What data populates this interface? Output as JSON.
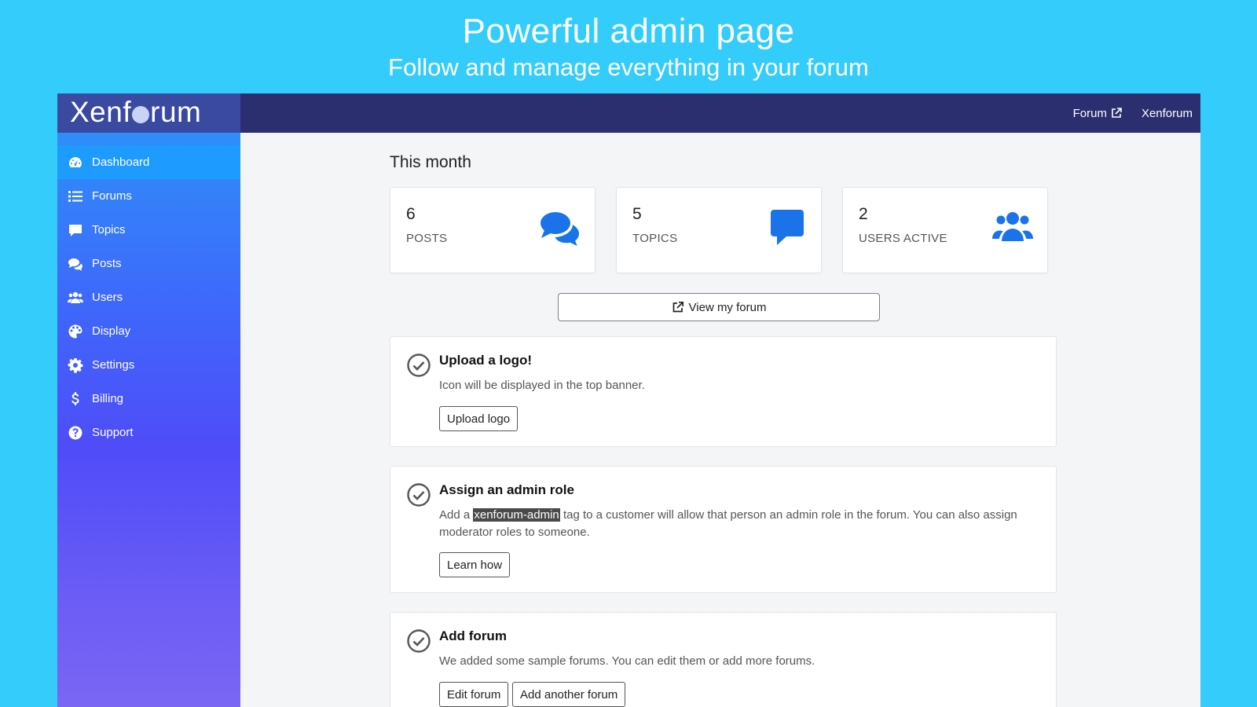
{
  "banner": {
    "title": "Powerful admin page",
    "subtitle": "Follow and manage everything in your forum"
  },
  "topbar": {
    "logo_left": "Xenf",
    "logo_right": "rum",
    "forum_link": "Forum",
    "user_link": "Xenforum"
  },
  "sidebar": {
    "items": [
      {
        "label": "Dashboard",
        "icon": "dashboard-icon"
      },
      {
        "label": "Forums",
        "icon": "list-icon"
      },
      {
        "label": "Topics",
        "icon": "comment-icon"
      },
      {
        "label": "Posts",
        "icon": "comments-icon"
      },
      {
        "label": "Users",
        "icon": "users-icon"
      },
      {
        "label": "Display",
        "icon": "palette-icon"
      },
      {
        "label": "Settings",
        "icon": "gear-icon"
      },
      {
        "label": "Billing",
        "icon": "dollar-icon"
      },
      {
        "label": "Support",
        "icon": "question-icon"
      }
    ]
  },
  "main": {
    "section_title": "This month",
    "stats": [
      {
        "value": "6",
        "label": "POSTS",
        "icon": "comments-icon"
      },
      {
        "value": "5",
        "label": "TOPICS",
        "icon": "comment-icon"
      },
      {
        "value": "2",
        "label": "USERS ACTIVE",
        "icon": "users-icon"
      }
    ],
    "view_button": "View my forum",
    "tasks": [
      {
        "title": "Upload a logo!",
        "desc": "Icon will be displayed in the top banner.",
        "buttons": [
          "Upload logo"
        ]
      },
      {
        "title": "Assign an admin role",
        "desc_prefix": "Add a",
        "desc_tag": "xenforum-admin",
        "desc_suffix": "tag to a customer will allow that person an admin role in the forum. You can also assign moderator roles to someone.",
        "buttons": [
          "Learn how"
        ]
      },
      {
        "title": "Add forum",
        "desc": "We added some sample forums. You can edit them or add more forums.",
        "buttons": [
          "Edit forum",
          "Add another forum"
        ]
      }
    ]
  },
  "colors": {
    "background": "#33ccfb",
    "topbar": "#2b2f6f",
    "active_nav": "#1e9bff",
    "stat_icon": "#1a73e8"
  }
}
